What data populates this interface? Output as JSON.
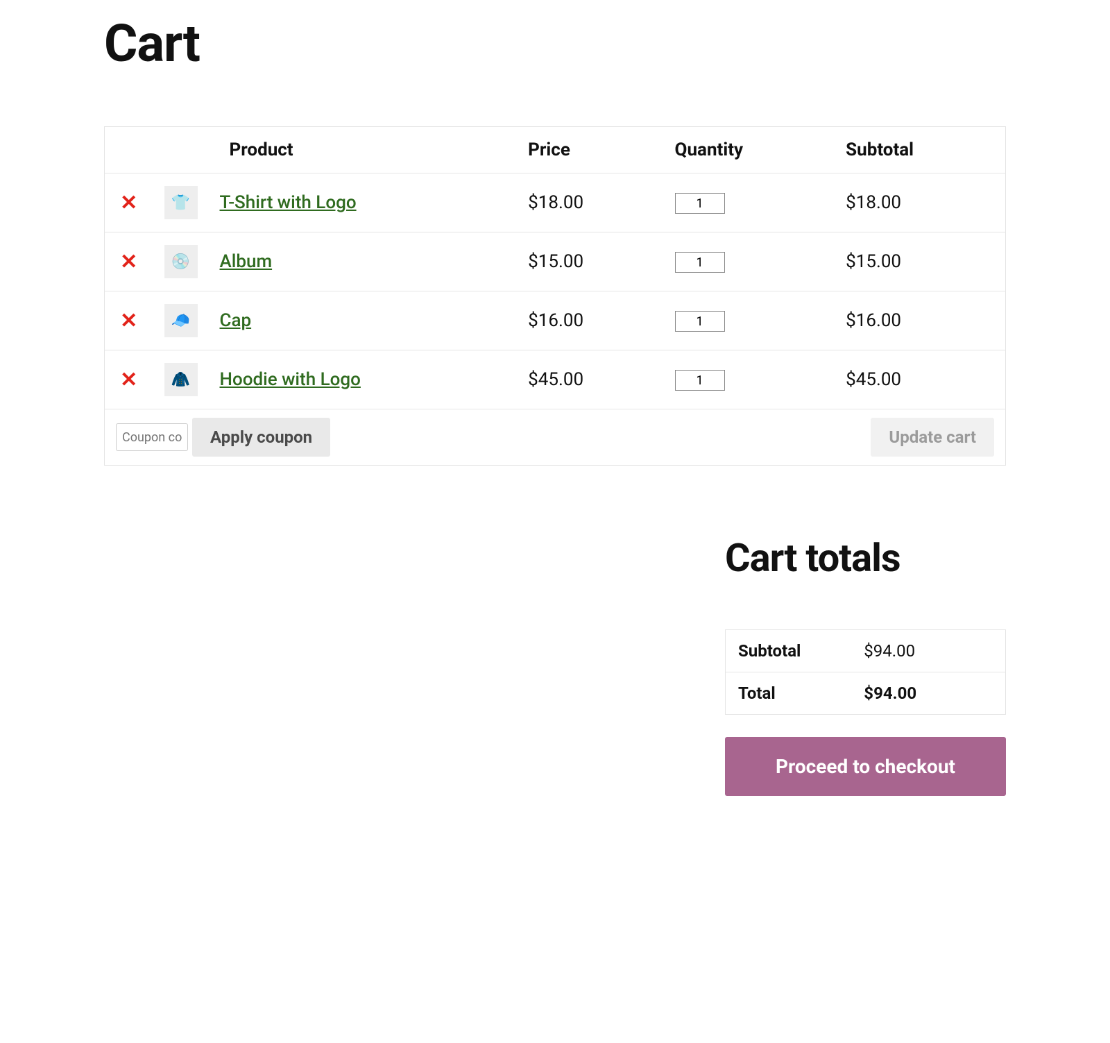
{
  "page": {
    "title": "Cart"
  },
  "table": {
    "headers": {
      "product": "Product",
      "price": "Price",
      "quantity": "Quantity",
      "subtotal": "Subtotal"
    },
    "items": [
      {
        "name": "T-Shirt with Logo",
        "price": "$18.00",
        "quantity": "1",
        "subtotal": "$18.00",
        "thumb_emoji": "👕"
      },
      {
        "name": "Album",
        "price": "$15.00",
        "quantity": "1",
        "subtotal": "$15.00",
        "thumb_emoji": "💿"
      },
      {
        "name": "Cap",
        "price": "$16.00",
        "quantity": "1",
        "subtotal": "$16.00",
        "thumb_emoji": "🧢"
      },
      {
        "name": "Hoodie with Logo",
        "price": "$45.00",
        "quantity": "1",
        "subtotal": "$45.00",
        "thumb_emoji": "🧥"
      }
    ]
  },
  "coupon": {
    "placeholder": "Coupon code",
    "apply_label": "Apply coupon"
  },
  "actions": {
    "update_label": "Update cart"
  },
  "totals": {
    "title": "Cart totals",
    "subtotal_label": "Subtotal",
    "subtotal_value": "$94.00",
    "total_label": "Total",
    "total_value": "$94.00",
    "checkout_label": "Proceed to checkout"
  },
  "icons": {
    "remove": "✕"
  }
}
